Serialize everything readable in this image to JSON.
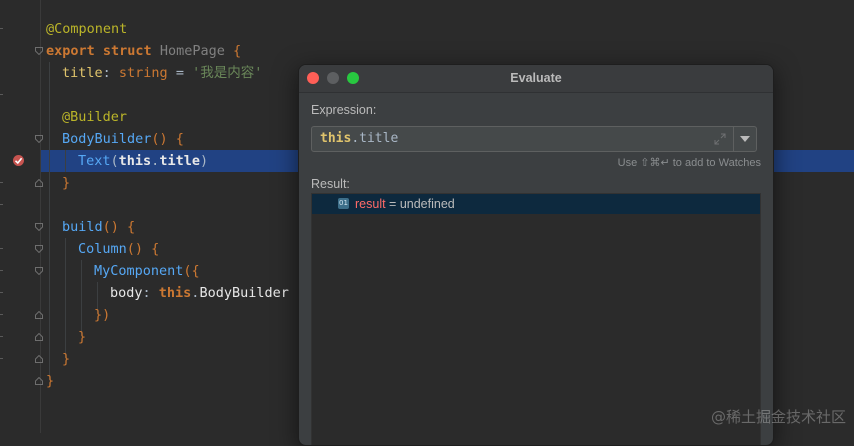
{
  "editor": {
    "lines": {
      "l1": {
        "annotation": "@Component"
      },
      "l2": {
        "kw1": "export",
        "kw2": "struct",
        "name": "HomePage",
        "brace": " {"
      },
      "l3": {
        "prop": "title",
        "colon": ": ",
        "type": "string",
        "eq": " = ",
        "value": "'我是内容'"
      },
      "l5": {
        "annotation": "@Builder"
      },
      "l6": {
        "fn": "BodyBuilder",
        "rest": "() {"
      },
      "l7": {
        "fn": "Text",
        "open": "(",
        "this": "this",
        "dot": ".",
        "prop": "title",
        "close": ")"
      },
      "l8": {
        "brace": "}"
      },
      "l10": {
        "fn": "build",
        "rest": "() {"
      },
      "l11": {
        "fn": "Column",
        "rest": "() {"
      },
      "l12": {
        "fn": "MyComponent",
        "rest": "({"
      },
      "l13": {
        "key": "body",
        "colon": ": ",
        "this": "this",
        "dot": ".",
        "prop": "BodyBuilder"
      },
      "l14": {
        "close": "})"
      },
      "l15": {
        "brace": "}"
      },
      "l16": {
        "brace": "}"
      },
      "l17": {
        "brace": "}"
      }
    }
  },
  "dialog": {
    "title": "Evaluate",
    "expression_label": "Expression:",
    "expression": {
      "this": "this",
      "rest": ".title"
    },
    "hint": "Use ⇧⌘↵ to add to Watches",
    "result_label": "Result:",
    "result": {
      "icon_text": "01",
      "name": "result",
      "eq": " = ",
      "value": "undefined"
    }
  },
  "watermark": "@稀土掘金技术社区",
  "colors": {
    "highlight": "#214283",
    "keyword": "#cc7832",
    "function": "#56a8f5",
    "result_name": "#ff6b68"
  }
}
